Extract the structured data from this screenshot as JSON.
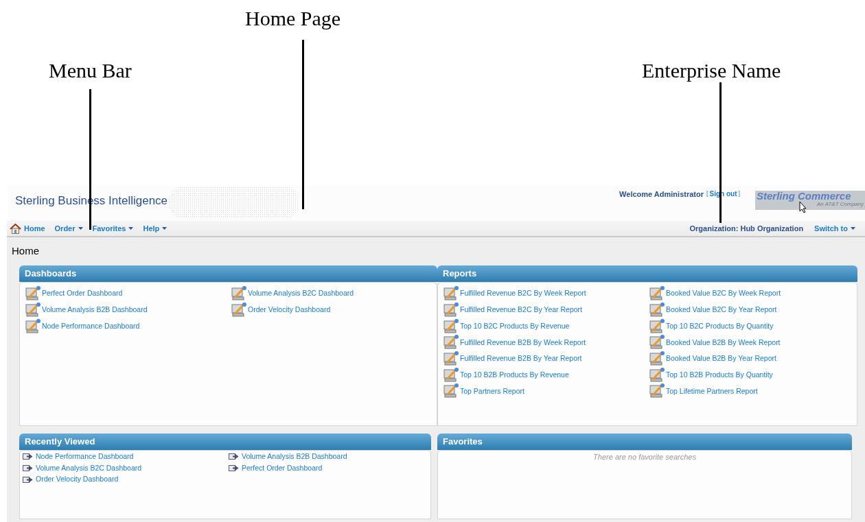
{
  "callouts": [
    {
      "label": "Home Page"
    },
    {
      "label": "Menu Bar"
    },
    {
      "label": "Enterprise Name"
    }
  ],
  "header": {
    "app_title": "Sterling Business Intelligence",
    "welcome": "Welcome Administrator",
    "sign_out": "Sign out",
    "sign_out_open": "[",
    "sign_out_close": "]",
    "logo_name": "Sterling Commerce",
    "logo_tagline": "An AT&T Company"
  },
  "menu": {
    "items": [
      {
        "label": "Home",
        "kind": "home"
      },
      {
        "label": "Order",
        "kind": "dropdown"
      },
      {
        "label": "Favorites",
        "kind": "dropdown"
      },
      {
        "label": "Help",
        "kind": "dropdown"
      }
    ],
    "organization": "Organization: Hub Organization",
    "switch_to": "Switch to"
  },
  "page_title": "Home",
  "dashboards": {
    "title": "Dashboards",
    "items": [
      "Perfect Order Dashboard",
      "Volume Analysis B2B Dashboard",
      "Node Performance Dashboard",
      "Volume Analysis B2C Dashboard",
      "Order Velocity Dashboard"
    ]
  },
  "reports": {
    "title": "Reports",
    "items": [
      "Fulfilled Revenue B2C By Week Report",
      "Fulfilled Revenue B2C By Year Report",
      "Top 10 B2C Products By Revenue",
      "Fulfilled Revenue B2B By Week Report",
      "Fulfilled Revenue B2B By Year Report",
      "Top 10 B2B Products By Revenue",
      "Top Partners Report",
      "Booked Value B2C By Week Report",
      "Booked Value B2C By Year Report",
      "Top 10 B2C Products By Quantity",
      "Booked Value B2B By Week Report",
      "Booked Value B2B By Year Report",
      "Top 10 B2B Products By Quantity",
      "Top Lifetime Partners Report"
    ]
  },
  "recently_viewed": {
    "title": "Recently Viewed",
    "items": [
      "Node Performance Dashboard",
      "Volume Analysis B2C Dashboard",
      "Order Velocity Dashboard",
      "Volume Analysis B2B Dashboard",
      "Perfect Order Dashboard"
    ]
  },
  "favorites": {
    "title": "Favorites",
    "empty_message": "There are no favorite searches"
  }
}
